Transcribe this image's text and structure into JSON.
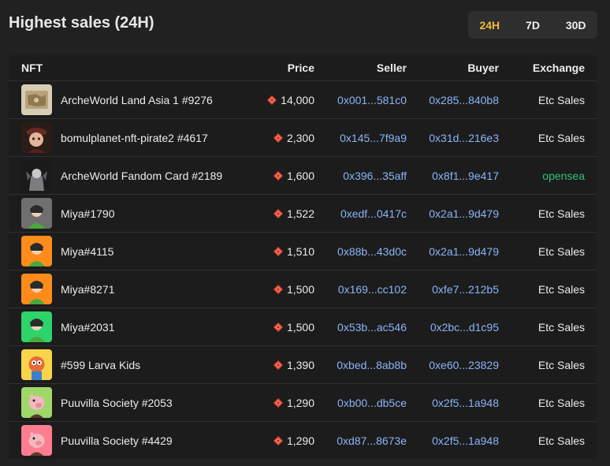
{
  "title": "Highest sales (24H)",
  "tabs": [
    {
      "label": "24H",
      "active": true
    },
    {
      "label": "7D",
      "active": false
    },
    {
      "label": "30D",
      "active": false
    }
  ],
  "columns": {
    "nft": "NFT",
    "price": "Price",
    "seller": "Seller",
    "buyer": "Buyer",
    "exchange": "Exchange"
  },
  "colors": {
    "accent": "#f5b93d",
    "link": "#8ab4f8",
    "opensea": "#2ec27e",
    "coin": "#e0463a"
  },
  "rows": [
    {
      "name": "ArcheWorld Land Asia 1 #9276",
      "price": "14,000",
      "seller": "0x001...581c0",
      "buyer": "0x285...840b8",
      "exchange": "Etc Sales",
      "thumb": "land-map-icon"
    },
    {
      "name": "bomulplanet-nft-pirate2 #4617",
      "price": "2,300",
      "seller": "0x145...7f9a9",
      "buyer": "0x31d...216e3",
      "exchange": "Etc Sales",
      "thumb": "pirate-avatar-icon"
    },
    {
      "name": "ArcheWorld Fandom Card #2189",
      "price": "1,600",
      "seller": "0x396...35aff",
      "buyer": "0x8f1...9e417",
      "exchange": "opensea",
      "thumb": "armored-warrior-icon"
    },
    {
      "name": "Miya#1790",
      "price": "1,522",
      "seller": "0xedf...0417c",
      "buyer": "0x2a1...9d479",
      "exchange": "Etc Sales",
      "thumb": "miya-avatar-icon"
    },
    {
      "name": "Miya#4115",
      "price": "1,510",
      "seller": "0x88b...43d0c",
      "buyer": "0x2a1...9d479",
      "exchange": "Etc Sales",
      "thumb": "miya-avatar-icon"
    },
    {
      "name": "Miya#8271",
      "price": "1,500",
      "seller": "0x169...cc102",
      "buyer": "0xfe7...212b5",
      "exchange": "Etc Sales",
      "thumb": "miya-avatar-icon"
    },
    {
      "name": "Miya#2031",
      "price": "1,500",
      "seller": "0x53b...ac546",
      "buyer": "0x2bc...d1c95",
      "exchange": "Etc Sales",
      "thumb": "miya-avatar-icon"
    },
    {
      "name": "#599 Larva Kids",
      "price": "1,390",
      "seller": "0xbed...8ab8b",
      "buyer": "0xe60...23829",
      "exchange": "Etc Sales",
      "thumb": "larva-kid-icon"
    },
    {
      "name": "Puuvilla Society #2053",
      "price": "1,290",
      "seller": "0xb00...db5ce",
      "buyer": "0x2f5...1a948",
      "exchange": "Etc Sales",
      "thumb": "puuvilla-pig-icon"
    },
    {
      "name": "Puuvilla Society #4429",
      "price": "1,290",
      "seller": "0xd87...8673e",
      "buyer": "0x2f5...1a948",
      "exchange": "Etc Sales",
      "thumb": "puuvilla-pig-icon"
    }
  ]
}
